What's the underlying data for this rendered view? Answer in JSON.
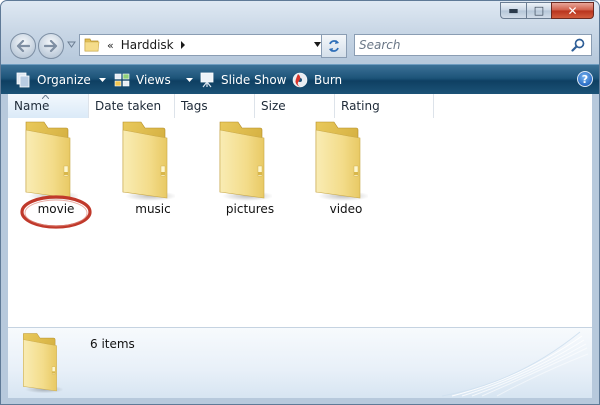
{
  "window": {
    "caption_buttons": {
      "minimize": "minimize",
      "maximize": "maximize",
      "close": "close"
    }
  },
  "address_bar": {
    "chevrons": "«",
    "breadcrumb": [
      "Harddisk"
    ]
  },
  "search": {
    "placeholder": "Search"
  },
  "toolbar": {
    "organize_label": "Organize",
    "views_label": "Views",
    "slideshow_label": "Slide Show",
    "burn_label": "Burn",
    "help_label": "?"
  },
  "columns": [
    "Name",
    "Date taken",
    "Tags",
    "Size",
    "Rating"
  ],
  "items": [
    {
      "label": "movie",
      "icon": "folder-icon",
      "highlighted": true
    },
    {
      "label": "music",
      "icon": "folder-icon"
    },
    {
      "label": "pictures",
      "icon": "folder-icon"
    },
    {
      "label": "video",
      "icon": "folder-icon"
    }
  ],
  "details": {
    "item_count": "6 items"
  },
  "colors": {
    "toolbar": "#1d5479",
    "annotation_ring": "#c0392b",
    "folder": "#f2d97a"
  }
}
